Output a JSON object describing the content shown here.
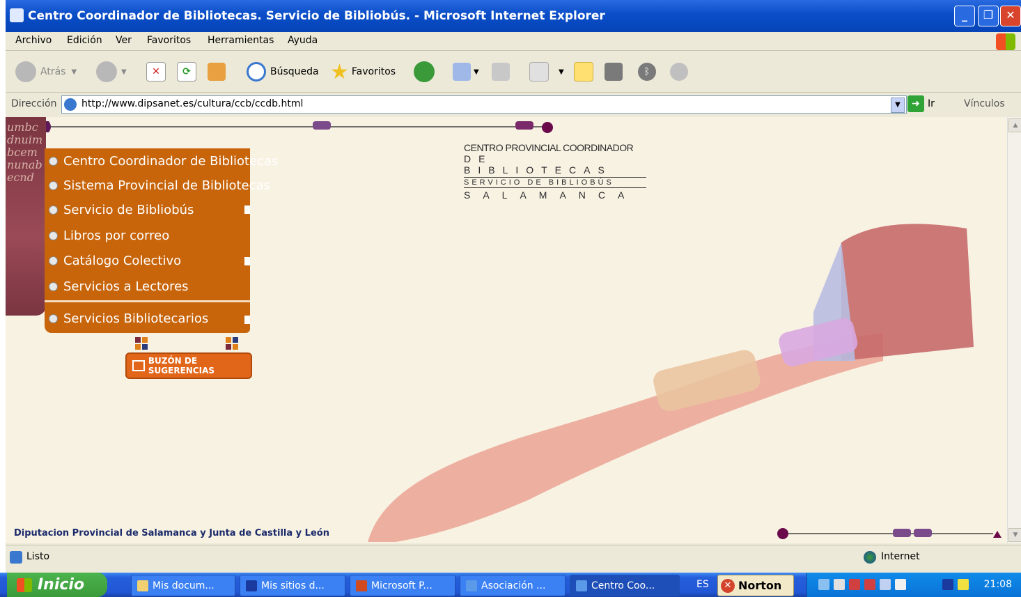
{
  "window": {
    "title": "Centro Coordinador de Bibliotecas. Servicio de Bibliobús. - Microsoft Internet Explorer"
  },
  "menu": [
    "Archivo",
    "Edición",
    "Ver",
    "Favoritos",
    "Herramientas",
    "Ayuda"
  ],
  "toolbar": {
    "back": "Atrás",
    "search": "Búsqueda",
    "favorites": "Favoritos"
  },
  "address": {
    "label": "Dirección",
    "url": "http://www.dipsanet.es/cultura/ccb/ccdb.html",
    "go": "Ir",
    "links": "Vínculos"
  },
  "page": {
    "nav": [
      "Centro Coordinador de Bibliotecas",
      "Sistema Provincial de Bibliotecas",
      "Servicio de Bibliobús",
      "Libros por correo",
      "Catálogo Colectivo",
      "Servicios a Lectores",
      "Servicios Bibliotecarios"
    ],
    "buzon": "BUZÓN DE SUGERENCIAS",
    "logo": {
      "line1": "CENTRO PROVINCIAL COORDINADOR",
      "line2": "DE BIBLIOTECAS",
      "line3": "SERVICIO DE BIBLIOBÚS",
      "line4": "SALAMANCA"
    },
    "footer": "Diputacion Provincial de Salamanca y Junta de Castilla y León",
    "deco_letters": "umbcdnuimbcemnunabecnd"
  },
  "status": {
    "text": "Listo",
    "zone": "Internet"
  },
  "taskbar": {
    "start": "Inicio",
    "tasks": [
      "Mis docum...",
      "Mis sitios d...",
      "Microsoft P...",
      "Asociación ...",
      "Centro Coo..."
    ],
    "lang": "ES",
    "norton": "Norton",
    "clock": "21:08"
  },
  "colors": {
    "nav_bg": "#c8650b",
    "deco_bg": "#7a3541",
    "page_bg": "#f8f2e3",
    "footer_text": "#1a2a6a"
  }
}
